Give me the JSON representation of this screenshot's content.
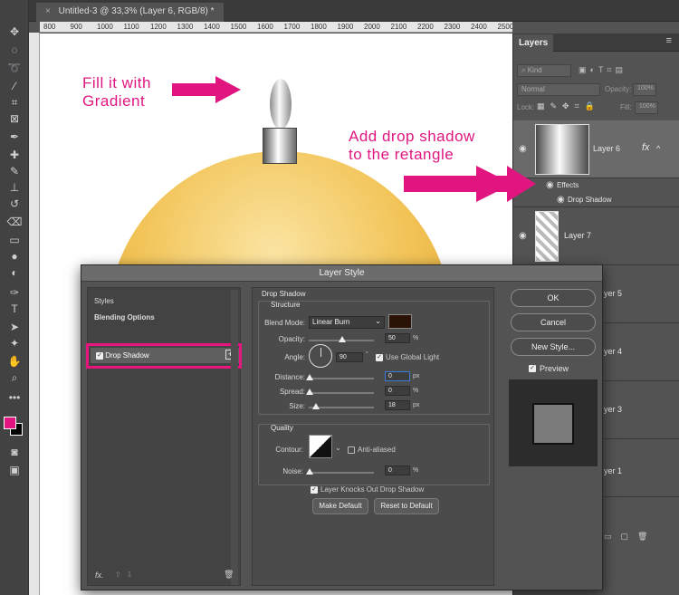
{
  "document_tab": {
    "close": "×",
    "title": "Untitled-3 @ 33,3% (Layer 6, RGB/8) *"
  },
  "ruler": {
    "ticks": [
      "800",
      "900",
      "1000",
      "1100",
      "1200",
      "1300",
      "1400",
      "1500",
      "1600",
      "1700",
      "1800",
      "1900",
      "2000",
      "2100",
      "2200",
      "2300",
      "2400",
      "2500"
    ]
  },
  "annotations": {
    "fill_gradient": [
      "Fill it with",
      "Gradient"
    ],
    "drop_shadow": [
      "Add drop shadow",
      "to the retangle"
    ],
    "color": "#e0157f"
  },
  "toolbar": {
    "icons": [
      "move-icon",
      "marquee-icon",
      "lasso-icon",
      "magic-wand-icon",
      "crop-icon",
      "frame-icon",
      "eyedropper-icon",
      "healing-icon",
      "brush-icon",
      "stamp-icon",
      "history-brush-icon",
      "eraser-icon",
      "gradient-icon",
      "blur-icon",
      "dodge-icon",
      "pen-icon",
      "type-icon",
      "path-select-icon",
      "shape-icon",
      "hand-icon",
      "zoom-icon",
      "more-icon"
    ],
    "foreground": "#e0157f",
    "background": "#000000"
  },
  "layers_panel": {
    "tab": "Layers",
    "kind": "Kind",
    "blend_mode": "Normal",
    "opacity_label": "Opacity:",
    "opacity_value": "100%",
    "lock_label": "Lock:",
    "fill_label": "Fill:",
    "fill_value": "100%",
    "layers": [
      {
        "name": "Layer 6",
        "fx": "fx",
        "effects_label": "Effects",
        "effect": "Drop Shadow"
      },
      {
        "name": "Layer 7"
      },
      {
        "name": "Layer 5"
      },
      {
        "name": "Layer 4"
      },
      {
        "name": "Layer 3"
      },
      {
        "name": "Layer 1"
      }
    ],
    "partial_names": [
      "yer 5",
      "yer 4",
      "yer 3",
      "yer 1"
    ]
  },
  "dialog": {
    "title": "Layer Style",
    "left": {
      "styles": "Styles",
      "blending": "Blending Options",
      "drop_shadow": "Drop Shadow"
    },
    "drop_shadow": {
      "section": "Drop Shadow",
      "structure": "Structure",
      "blend_mode_label": "Blend Mode:",
      "blend_mode": "Linear Burn",
      "shadow_color": "#2a1206",
      "opacity_label": "Opacity:",
      "opacity": "50",
      "angle_label": "Angle:",
      "angle": "90",
      "global_light": "Use Global Light",
      "distance_label": "Distance:",
      "distance": "0",
      "spread_label": "Spread:",
      "spread": "0",
      "size_label": "Size:",
      "size": "18",
      "quality": "Quality",
      "contour_label": "Contour:",
      "anti_aliased": "Anti-aliased",
      "noise_label": "Noise:",
      "noise": "0",
      "knocks_out": "Layer Knocks Out Drop Shadow",
      "make_default": "Make Default",
      "reset_default": "Reset to Default",
      "units": {
        "pct": "%",
        "px": "px",
        "deg": "°"
      }
    },
    "buttons": {
      "ok": "OK",
      "cancel": "Cancel",
      "new_style": "New Style...",
      "preview": "Preview"
    }
  }
}
